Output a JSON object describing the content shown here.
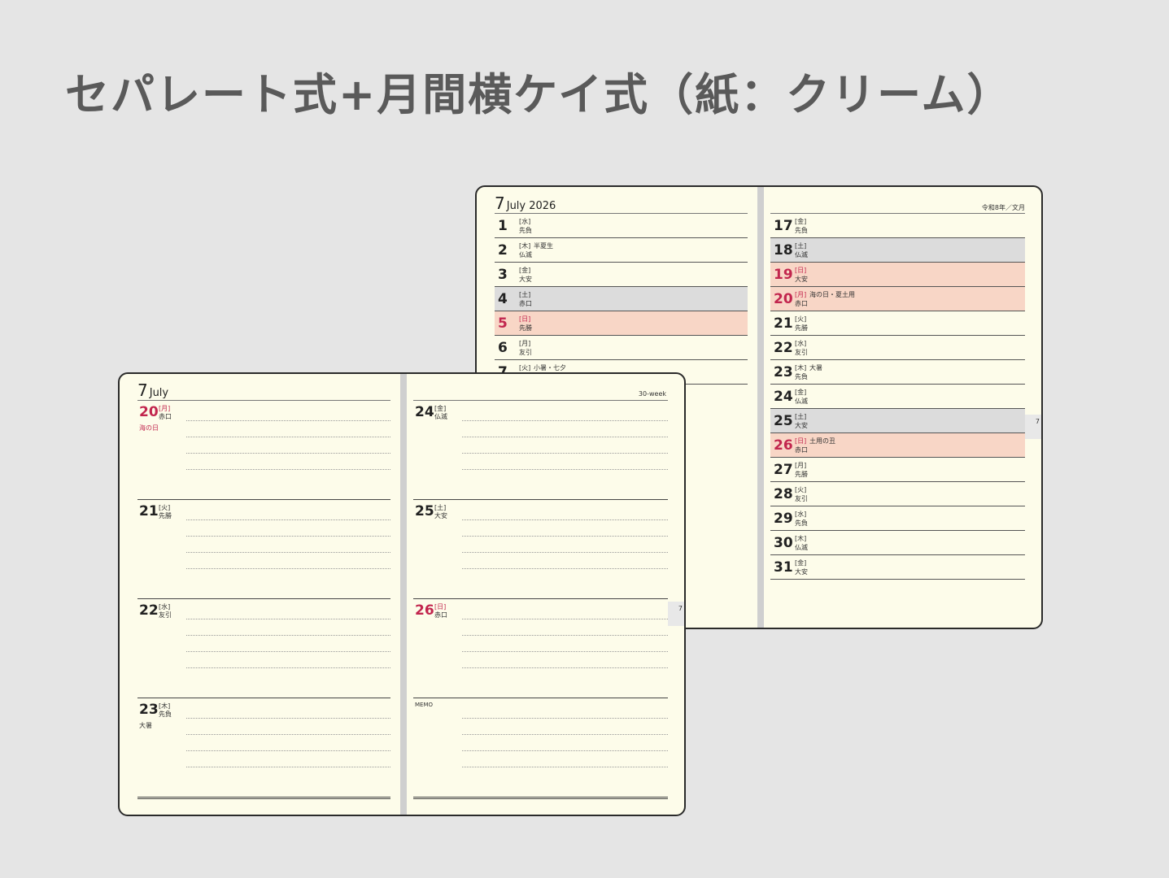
{
  "title": "セパレート式+月間横ケイ式（紙：クリーム）",
  "colors": {
    "sunday": "#c2264e",
    "saturday_bg": "#dcdcdc",
    "sunday_bg": "#f8d6c6",
    "paper": "#fdfcea"
  },
  "monthly": {
    "month_num": "7",
    "month_label": "July 2026",
    "wareki": "令和8年／文月",
    "left_days": [
      {
        "d": "1",
        "wd": "[水]",
        "rk": "先負",
        "ev": "",
        "type": ""
      },
      {
        "d": "2",
        "wd": "[木]",
        "rk": "仏滅",
        "ev": "半夏生",
        "type": ""
      },
      {
        "d": "3",
        "wd": "[金]",
        "rk": "大安",
        "ev": "",
        "type": ""
      },
      {
        "d": "4",
        "wd": "[土]",
        "rk": "赤口",
        "ev": "",
        "type": "sat"
      },
      {
        "d": "5",
        "wd": "[日]",
        "rk": "先勝",
        "ev": "",
        "type": "sun"
      },
      {
        "d": "6",
        "wd": "[月]",
        "rk": "友引",
        "ev": "",
        "type": ""
      },
      {
        "d": "7",
        "wd": "[火]",
        "rk": "",
        "ev": "小暑・七夕",
        "type": ""
      }
    ],
    "right_days": [
      {
        "d": "17",
        "wd": "[金]",
        "rk": "先負",
        "ev": "",
        "type": ""
      },
      {
        "d": "18",
        "wd": "[土]",
        "rk": "仏滅",
        "ev": "",
        "type": "sat"
      },
      {
        "d": "19",
        "wd": "[日]",
        "rk": "大安",
        "ev": "",
        "type": "sun"
      },
      {
        "d": "20",
        "wd": "[月]",
        "rk": "赤口",
        "ev": "海の日・夏土用",
        "type": "sun"
      },
      {
        "d": "21",
        "wd": "[火]",
        "rk": "先勝",
        "ev": "",
        "type": ""
      },
      {
        "d": "22",
        "wd": "[水]",
        "rk": "友引",
        "ev": "",
        "type": ""
      },
      {
        "d": "23",
        "wd": "[木]",
        "rk": "先負",
        "ev": "大暑",
        "type": ""
      },
      {
        "d": "24",
        "wd": "[金]",
        "rk": "仏滅",
        "ev": "",
        "type": ""
      },
      {
        "d": "25",
        "wd": "[土]",
        "rk": "大安",
        "ev": "",
        "type": "sat"
      },
      {
        "d": "26",
        "wd": "[日]",
        "rk": "赤口",
        "ev": "土用の丑",
        "type": "sun"
      },
      {
        "d": "27",
        "wd": "[月]",
        "rk": "先勝",
        "ev": "",
        "type": ""
      },
      {
        "d": "28",
        "wd": "[火]",
        "rk": "友引",
        "ev": "",
        "type": ""
      },
      {
        "d": "29",
        "wd": "[水]",
        "rk": "先負",
        "ev": "",
        "type": ""
      },
      {
        "d": "30",
        "wd": "[木]",
        "rk": "仏滅",
        "ev": "",
        "type": ""
      },
      {
        "d": "31",
        "wd": "[金]",
        "rk": "大安",
        "ev": "",
        "type": ""
      }
    ],
    "tab_label": "7"
  },
  "weekly": {
    "month_num": "7",
    "month_label": "July",
    "week_label": "30-week",
    "memo_label": "MEMO",
    "tab_label": "7",
    "left_days": [
      {
        "d": "20",
        "wd": "[月]",
        "rk": "赤口",
        "hol": "海の日",
        "type": "sun"
      },
      {
        "d": "21",
        "wd": "[火]",
        "rk": "先勝",
        "hol": "",
        "type": ""
      },
      {
        "d": "22",
        "wd": "[水]",
        "rk": "友引",
        "hol": "",
        "type": ""
      },
      {
        "d": "23",
        "wd": "[木]",
        "rk": "先負",
        "hol": "大暑",
        "type": ""
      }
    ],
    "right_days": [
      {
        "d": "24",
        "wd": "[金]",
        "rk": "仏滅",
        "type": ""
      },
      {
        "d": "25",
        "wd": "[土]",
        "rk": "大安",
        "type": ""
      },
      {
        "d": "26",
        "wd": "[日]",
        "rk": "赤口",
        "type": "sun"
      }
    ]
  }
}
